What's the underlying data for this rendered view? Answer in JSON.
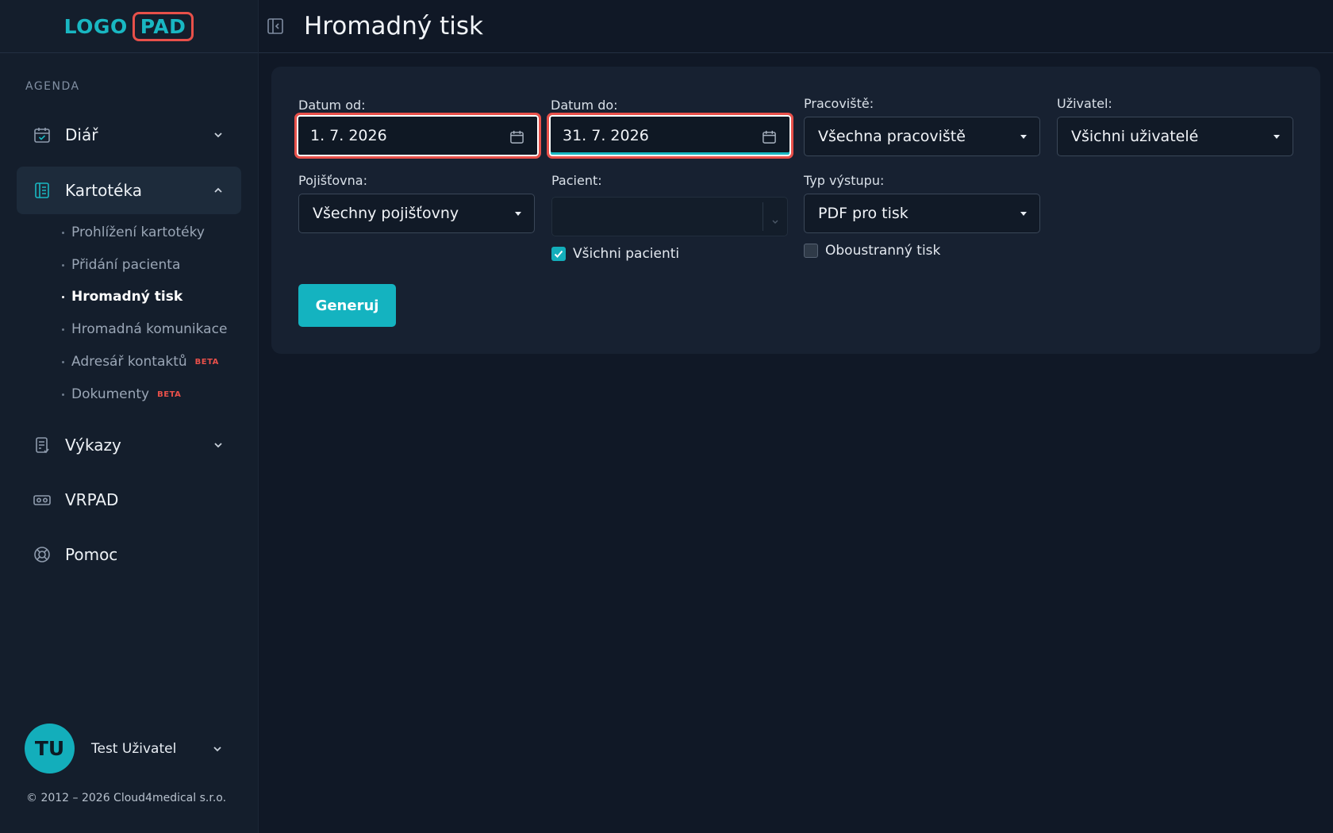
{
  "logo": {
    "part1": "LOGO",
    "part2": "PAD"
  },
  "sidebar": {
    "section_label": "AGENDA",
    "items": [
      {
        "label": "Diář",
        "icon": "calendar-check-icon"
      },
      {
        "label": "Kartotéka",
        "icon": "address-book-icon",
        "expanded": true
      },
      {
        "label": "Výkazy",
        "icon": "report-icon"
      },
      {
        "label": "VRPAD",
        "icon": "vr-headset-icon"
      },
      {
        "label": "Pomoc",
        "icon": "lifebuoy-icon"
      }
    ],
    "sub_items": [
      {
        "label": "Prohlížení kartotéky"
      },
      {
        "label": "Přidání pacienta"
      },
      {
        "label": "Hromadný tisk",
        "active": true
      },
      {
        "label": "Hromadná komunikace"
      },
      {
        "label": "Adresář kontaktů",
        "badge": "BETA"
      },
      {
        "label": "Dokumenty",
        "badge": "BETA"
      }
    ]
  },
  "user": {
    "initials": "TU",
    "name": "Test Uživatel"
  },
  "copyright": "© 2012 – 2026 Cloud4medical s.r.o.",
  "header": {
    "title": "Hromadný tisk"
  },
  "form": {
    "date_from": {
      "label": "Datum od:",
      "value": "1. 7. 2026"
    },
    "date_to": {
      "label": "Datum do:",
      "value": "31. 7. 2026"
    },
    "workplace": {
      "label": "Pracoviště:",
      "value": "Všechna pracoviště"
    },
    "user": {
      "label": "Uživatel:",
      "value": "Všichni uživatelé"
    },
    "insurance": {
      "label": "Pojišťovna:",
      "value": "Všechny pojišťovny"
    },
    "patient": {
      "label": "Pacient:",
      "value": ""
    },
    "output_type": {
      "label": "Typ výstupu:",
      "value": "PDF pro tisk"
    },
    "all_patients": {
      "label": "Všichni pacienti",
      "checked": true
    },
    "duplex": {
      "label": "Oboustranný tisk",
      "checked": false
    },
    "submit_label": "Generuj"
  },
  "colors": {
    "accent": "#13aebb",
    "highlight": "#e8504a",
    "background": "#101826",
    "sidebar": "#141e2c",
    "panel": "#172131"
  }
}
